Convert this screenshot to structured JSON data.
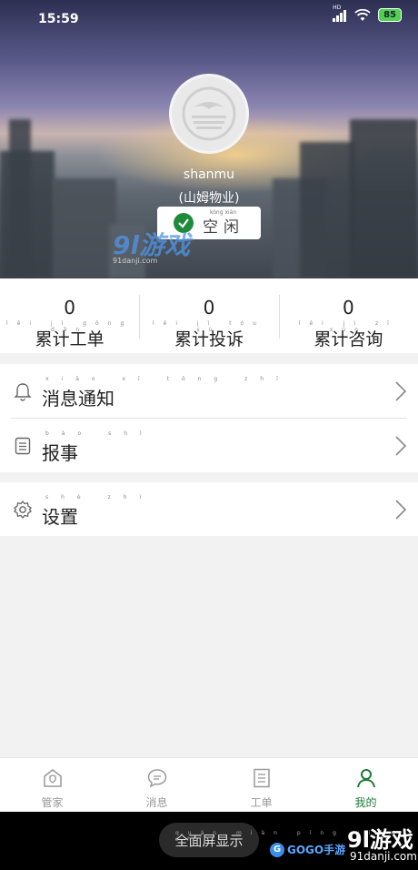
{
  "status_bar": {
    "time": "15:59",
    "network": "HD",
    "battery": "85"
  },
  "profile": {
    "username": "shanmu",
    "company": "(山姆物业)",
    "status": "空闲",
    "status_pinyin": "kòng xián"
  },
  "watermark": {
    "logo": "9l游戏",
    "site": "91danji.com"
  },
  "stats": [
    {
      "value": "0",
      "label": "累计工单",
      "pinyin": "lěi jì gōng dān"
    },
    {
      "value": "0",
      "label": "累计投诉",
      "pinyin": "lěi jì tóu sù"
    },
    {
      "value": "0",
      "label": "累计咨询",
      "pinyin": "lěi jì zī xún"
    }
  ],
  "menu": {
    "notifications": {
      "label": "消息通知",
      "pinyin": "xiāo xī tōng zhī"
    },
    "report": {
      "label": "报事",
      "pinyin": "bào shì"
    },
    "settings": {
      "label": "设置",
      "pinyin": "shè zhì"
    }
  },
  "nav": [
    {
      "label": "管家",
      "icon": "house-shield-icon",
      "active": false
    },
    {
      "label": "消息",
      "icon": "chat-bubble-icon",
      "active": false
    },
    {
      "label": "工单",
      "icon": "document-icon",
      "active": false
    },
    {
      "label": "我的",
      "icon": "person-icon",
      "active": true
    }
  ],
  "system_bar": {
    "fullscreen_label": "全面屏显示",
    "fullscreen_pinyin": "quán miàn píng xiǎn shì",
    "gogo_text": "GOGO手游",
    "brand": "9l游戏",
    "brand_site": "91danji.com"
  },
  "colors": {
    "accent": "#1e7a35",
    "background": "#f2f2f2"
  }
}
